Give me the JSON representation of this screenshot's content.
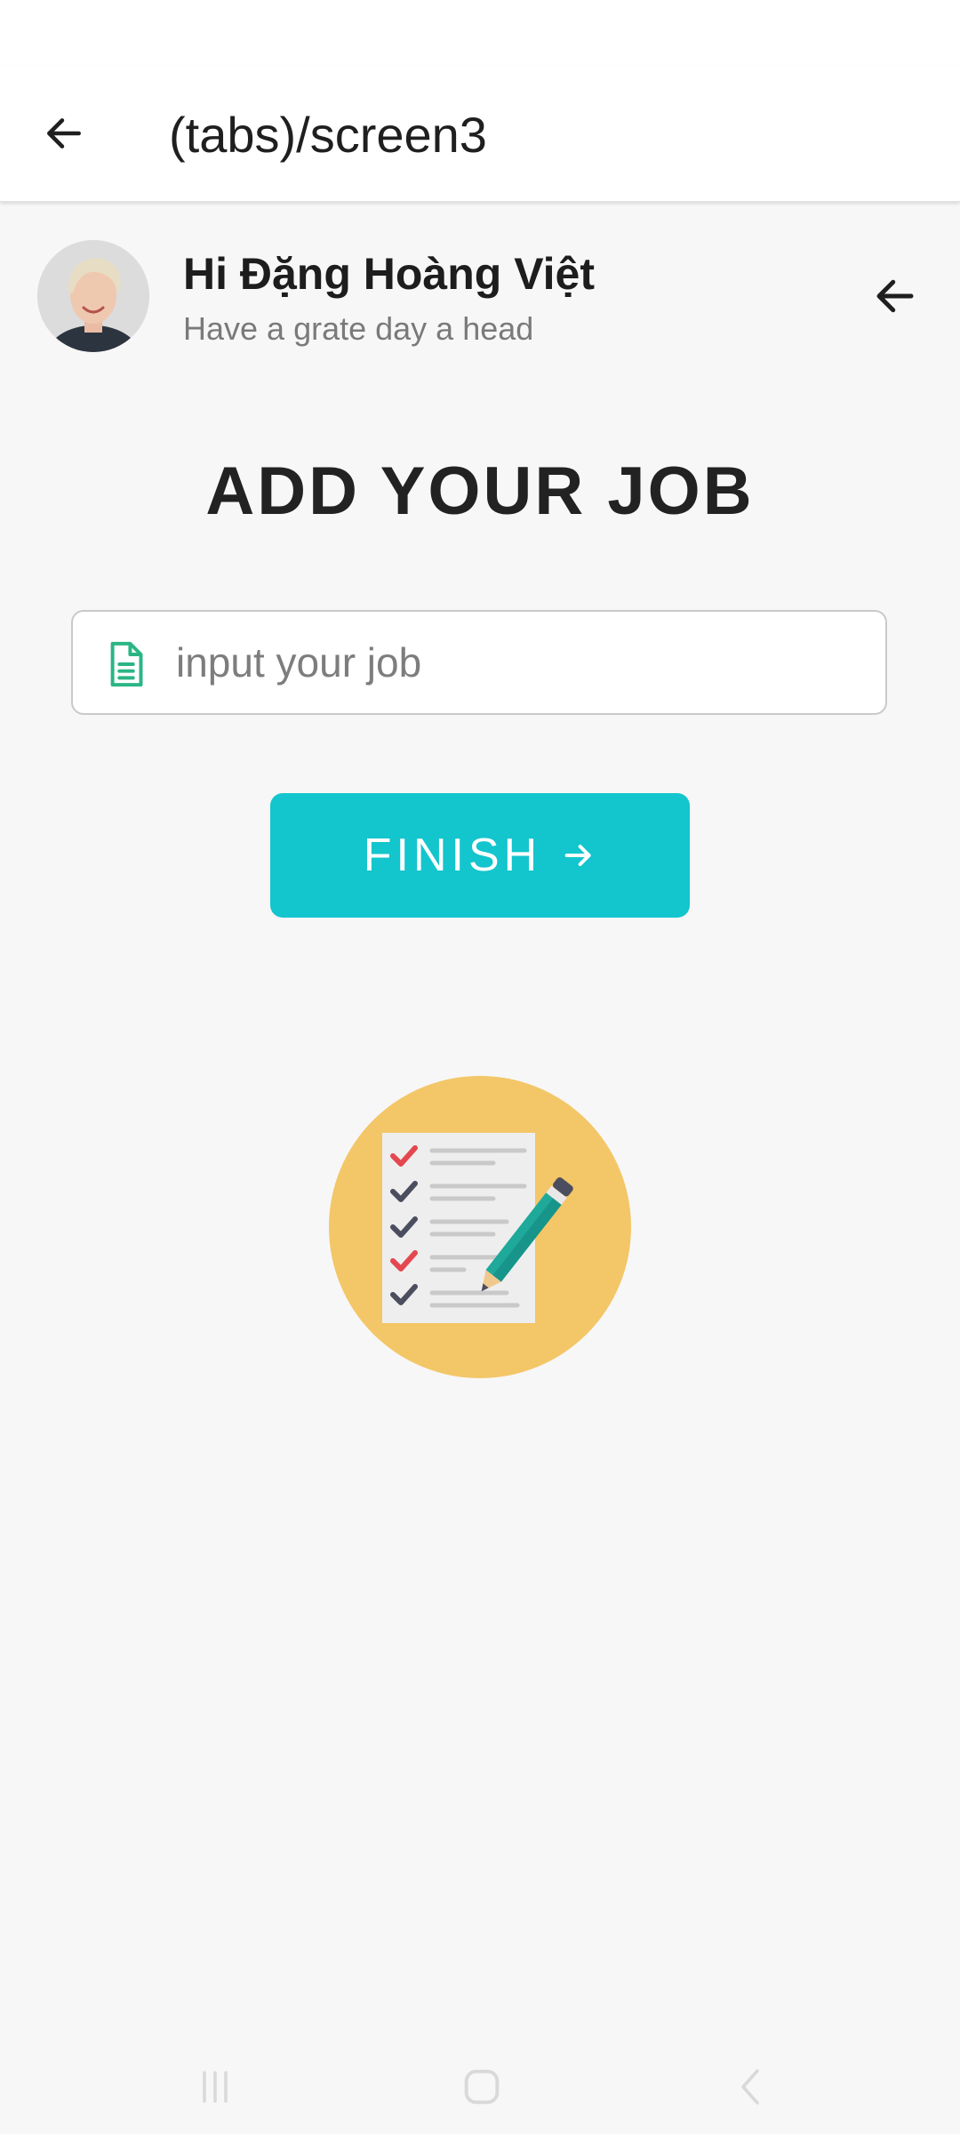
{
  "header": {
    "title": "(tabs)/screen3",
    "back_icon": "arrow-left-icon"
  },
  "profile": {
    "greeting": "Hi Đặng Hoàng Việt",
    "subtitle": "Have a grate day a head",
    "avatar_icon": "user-avatar",
    "back_icon": "arrow-left-icon"
  },
  "main": {
    "heading": "ADD YOUR JOB",
    "job_input": {
      "placeholder": "input your job",
      "value": "",
      "icon": "file-text-icon",
      "icon_color": "#2bb585"
    },
    "finish_button": {
      "label": "FINISH",
      "icon": "arrow-right-icon",
      "color": "#13c5cd"
    },
    "illustration": "checklist-pencil-illustration"
  },
  "nav_bar": {
    "recents_icon": "recents-icon",
    "home_icon": "home-icon",
    "back_icon": "back-chevron-icon"
  },
  "colors": {
    "background": "#f7f7f7",
    "header_bg": "#ffffff",
    "accent": "#13c5cd",
    "illustration_circle": "#f3c667"
  }
}
